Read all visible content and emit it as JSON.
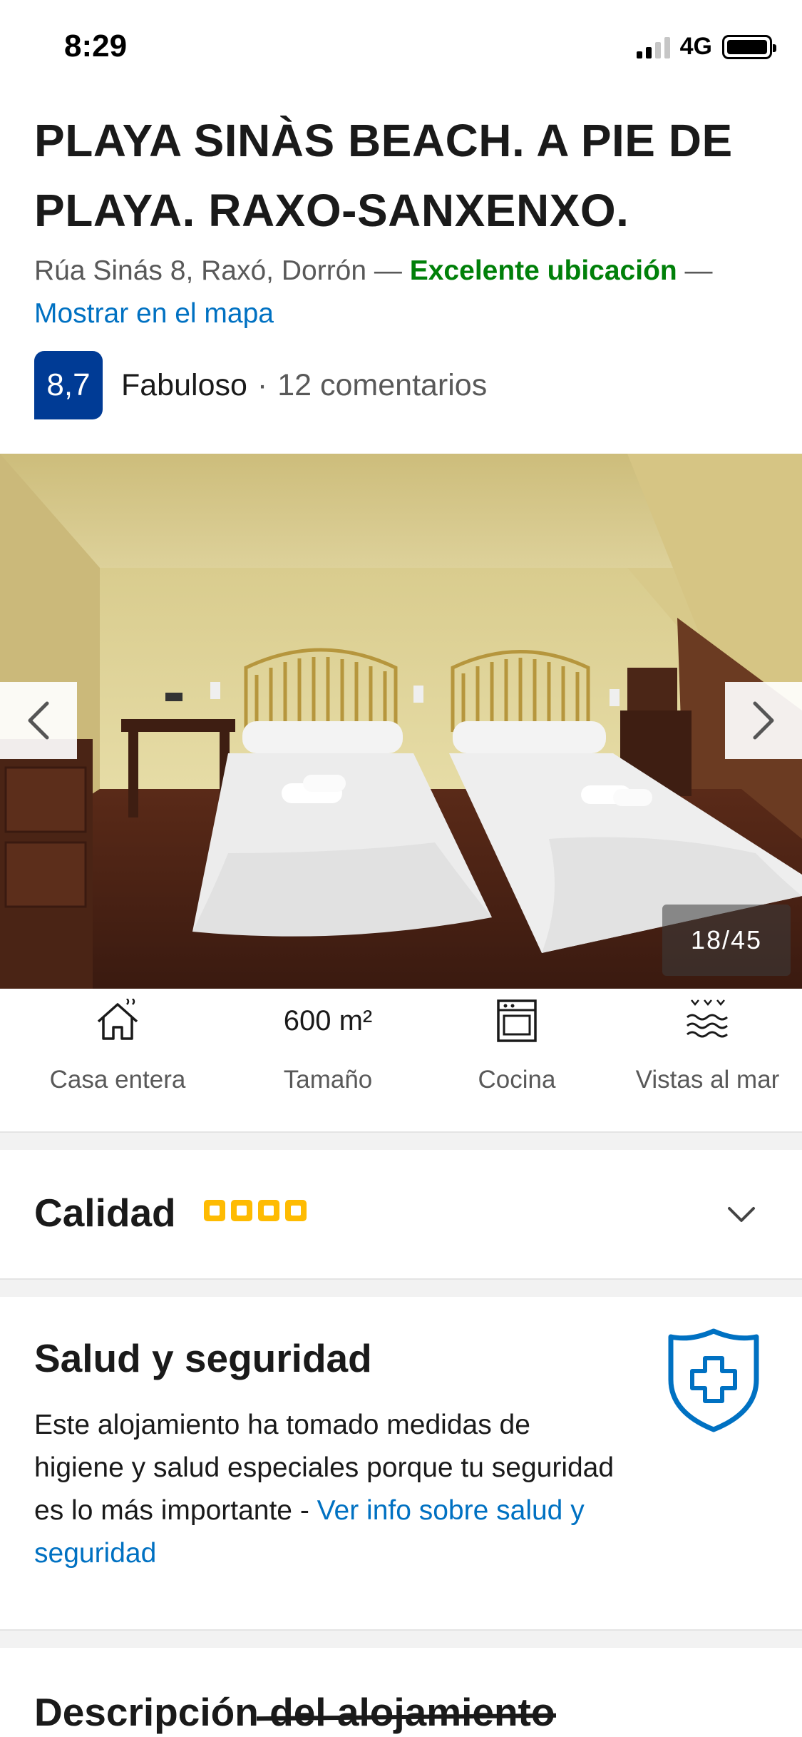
{
  "status_bar": {
    "time": "8:29",
    "network": "4G"
  },
  "property": {
    "title": "PLAYA SINÀS BEACH. A PIE DE PLAYA. RAXO-SANXENXO.",
    "address": "Rúa Sinás 8, Raxó, Dorrón",
    "separator": " — ",
    "location_highlight": "Excelente ubicación",
    "map_link": "Mostrar en el mapa"
  },
  "rating": {
    "score": "8,7",
    "word": "Fabuloso",
    "separator": "·",
    "reviews": "12 comentarios"
  },
  "gallery": {
    "counter": "18/45",
    "current": 18,
    "total": 45
  },
  "highlights": [
    {
      "icon": "house-icon",
      "value": "",
      "label": "Casa entera"
    },
    {
      "icon": "",
      "value": "600 m²",
      "label": "Tamaño"
    },
    {
      "icon": "stove-icon",
      "value": "",
      "label": "Cocina"
    },
    {
      "icon": "sea-view-icon",
      "value": "",
      "label": "Vistas al mar"
    }
  ],
  "quality": {
    "title": "Calidad",
    "stars": 4
  },
  "health": {
    "title": "Salud y seguridad",
    "text": "Este alojamiento ha tomado medidas de higiene y salud especiales porque tu seguridad es lo más importante - ",
    "link": "Ver info sobre salud y seguridad"
  },
  "description": {
    "title_start": "Descripción",
    "title_end": " del alojamiento"
  },
  "colors": {
    "brand_blue": "#003b95",
    "link_blue": "#0071c2",
    "green": "#008009",
    "star_yellow": "#febb02"
  }
}
